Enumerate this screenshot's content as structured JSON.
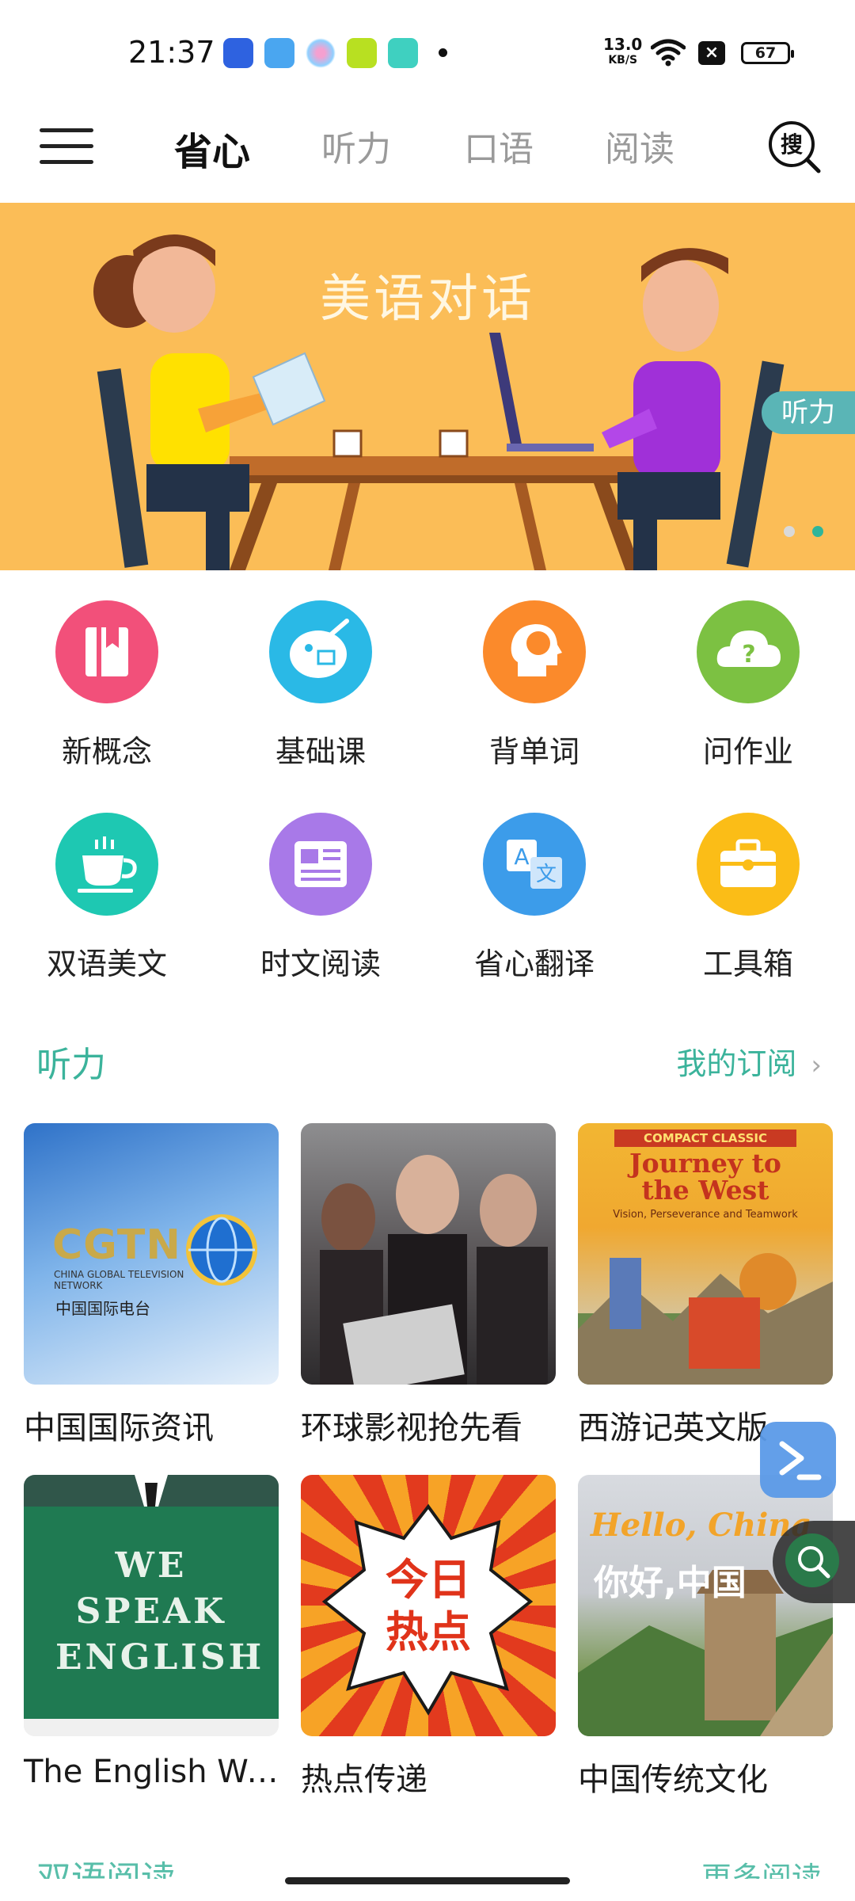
{
  "status_bar": {
    "time": "21:37",
    "net_speed": "13.0",
    "net_unit": "KB/S",
    "battery": "67"
  },
  "nav": {
    "tabs": [
      {
        "label": "省心",
        "active": true
      },
      {
        "label": "听力",
        "active": false
      },
      {
        "label": "口语",
        "active": false
      },
      {
        "label": "阅读",
        "active": false
      }
    ],
    "search_label": "搜"
  },
  "banner": {
    "title": "美语对话",
    "tag": "听力",
    "colors": {
      "background": "#fbbd57",
      "tag": "#5ab5b6"
    }
  },
  "features": [
    {
      "label": "新概念",
      "icon": "bookmark-book-icon",
      "color": "#f2507a"
    },
    {
      "label": "基础课",
      "icon": "palette-brush-icon",
      "color": "#2ab9e6"
    },
    {
      "label": "背单词",
      "icon": "head-abc-icon",
      "color": "#fb8a2b"
    },
    {
      "label": "问作业",
      "icon": "cloud-question-icon",
      "color": "#7cc142"
    },
    {
      "label": "双语美文",
      "icon": "coffee-cup-icon",
      "color": "#1ec8b2"
    },
    {
      "label": "时文阅读",
      "icon": "newspaper-icon",
      "color": "#a879e8"
    },
    {
      "label": "省心翻译",
      "icon": "translate-icon",
      "color": "#3c9cea"
    },
    {
      "label": "工具箱",
      "icon": "toolbox-icon",
      "color": "#fbbd17"
    }
  ],
  "section": {
    "title": "听力",
    "more_label": "我的订阅"
  },
  "cards": [
    {
      "title": "中国国际资讯",
      "thumb_text": "CGTN",
      "thumb_sub": "CHINA GLOBAL TELEVISION NETWORK",
      "thumb_cn": "中国国际电台"
    },
    {
      "title": "环球影视抢先看"
    },
    {
      "title": "西游记英文版",
      "thumb_badge": "COMPACT CLASSIC",
      "thumb_text": "Journey to the West",
      "thumb_sub": "Vision, Perseverance and Teamwork"
    },
    {
      "title": "The English We...",
      "thumb_text": "WE SPEAK ENGLISH"
    },
    {
      "title": "热点传递",
      "thumb_text": "今日热点"
    },
    {
      "title": "中国传统文化",
      "thumb_text": "Hello, China",
      "thumb_cn": "你好,中国"
    }
  ],
  "next_section": {
    "title": "双语阅读",
    "more_label": "更多阅读"
  }
}
